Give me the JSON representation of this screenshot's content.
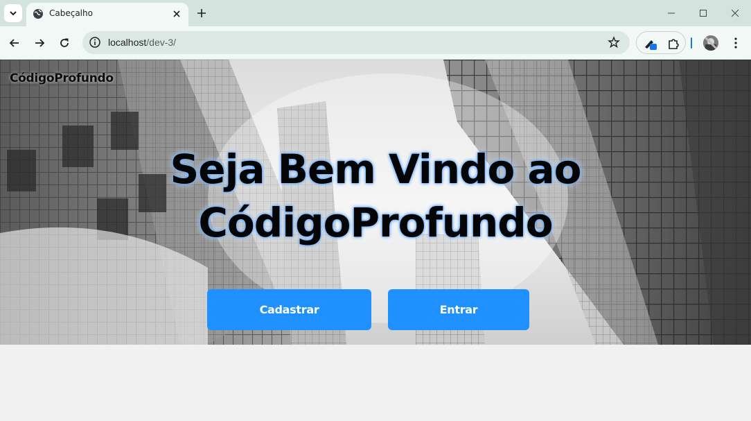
{
  "browser": {
    "tab": {
      "title": "Cabeçalho"
    },
    "address": {
      "host": "localhost",
      "path": "/dev-3/"
    }
  },
  "page": {
    "brand": "CódigoProfundo",
    "headline": [
      "Seja Bem Vindo ao",
      "CódigoProfundo"
    ],
    "buttons": {
      "register": "Cadastrar",
      "login": "Entrar"
    }
  },
  "colors": {
    "button_bg": "#1e90ff",
    "button_text": "#ffffff",
    "headline_glow": "#4b9bff",
    "tabbar": "#d3e3dd",
    "toolbar": "#f2f8f5"
  },
  "icons": [
    "tab-search-icon",
    "globe-icon",
    "close-icon",
    "plus-icon",
    "minimize-icon",
    "maximize-icon",
    "window-close-icon",
    "back-arrow-icon",
    "forward-arrow-icon",
    "reload-icon",
    "info-icon",
    "star-icon",
    "extension-pen-icon",
    "puzzle-icon",
    "avatar",
    "kebab-menu-icon"
  ]
}
